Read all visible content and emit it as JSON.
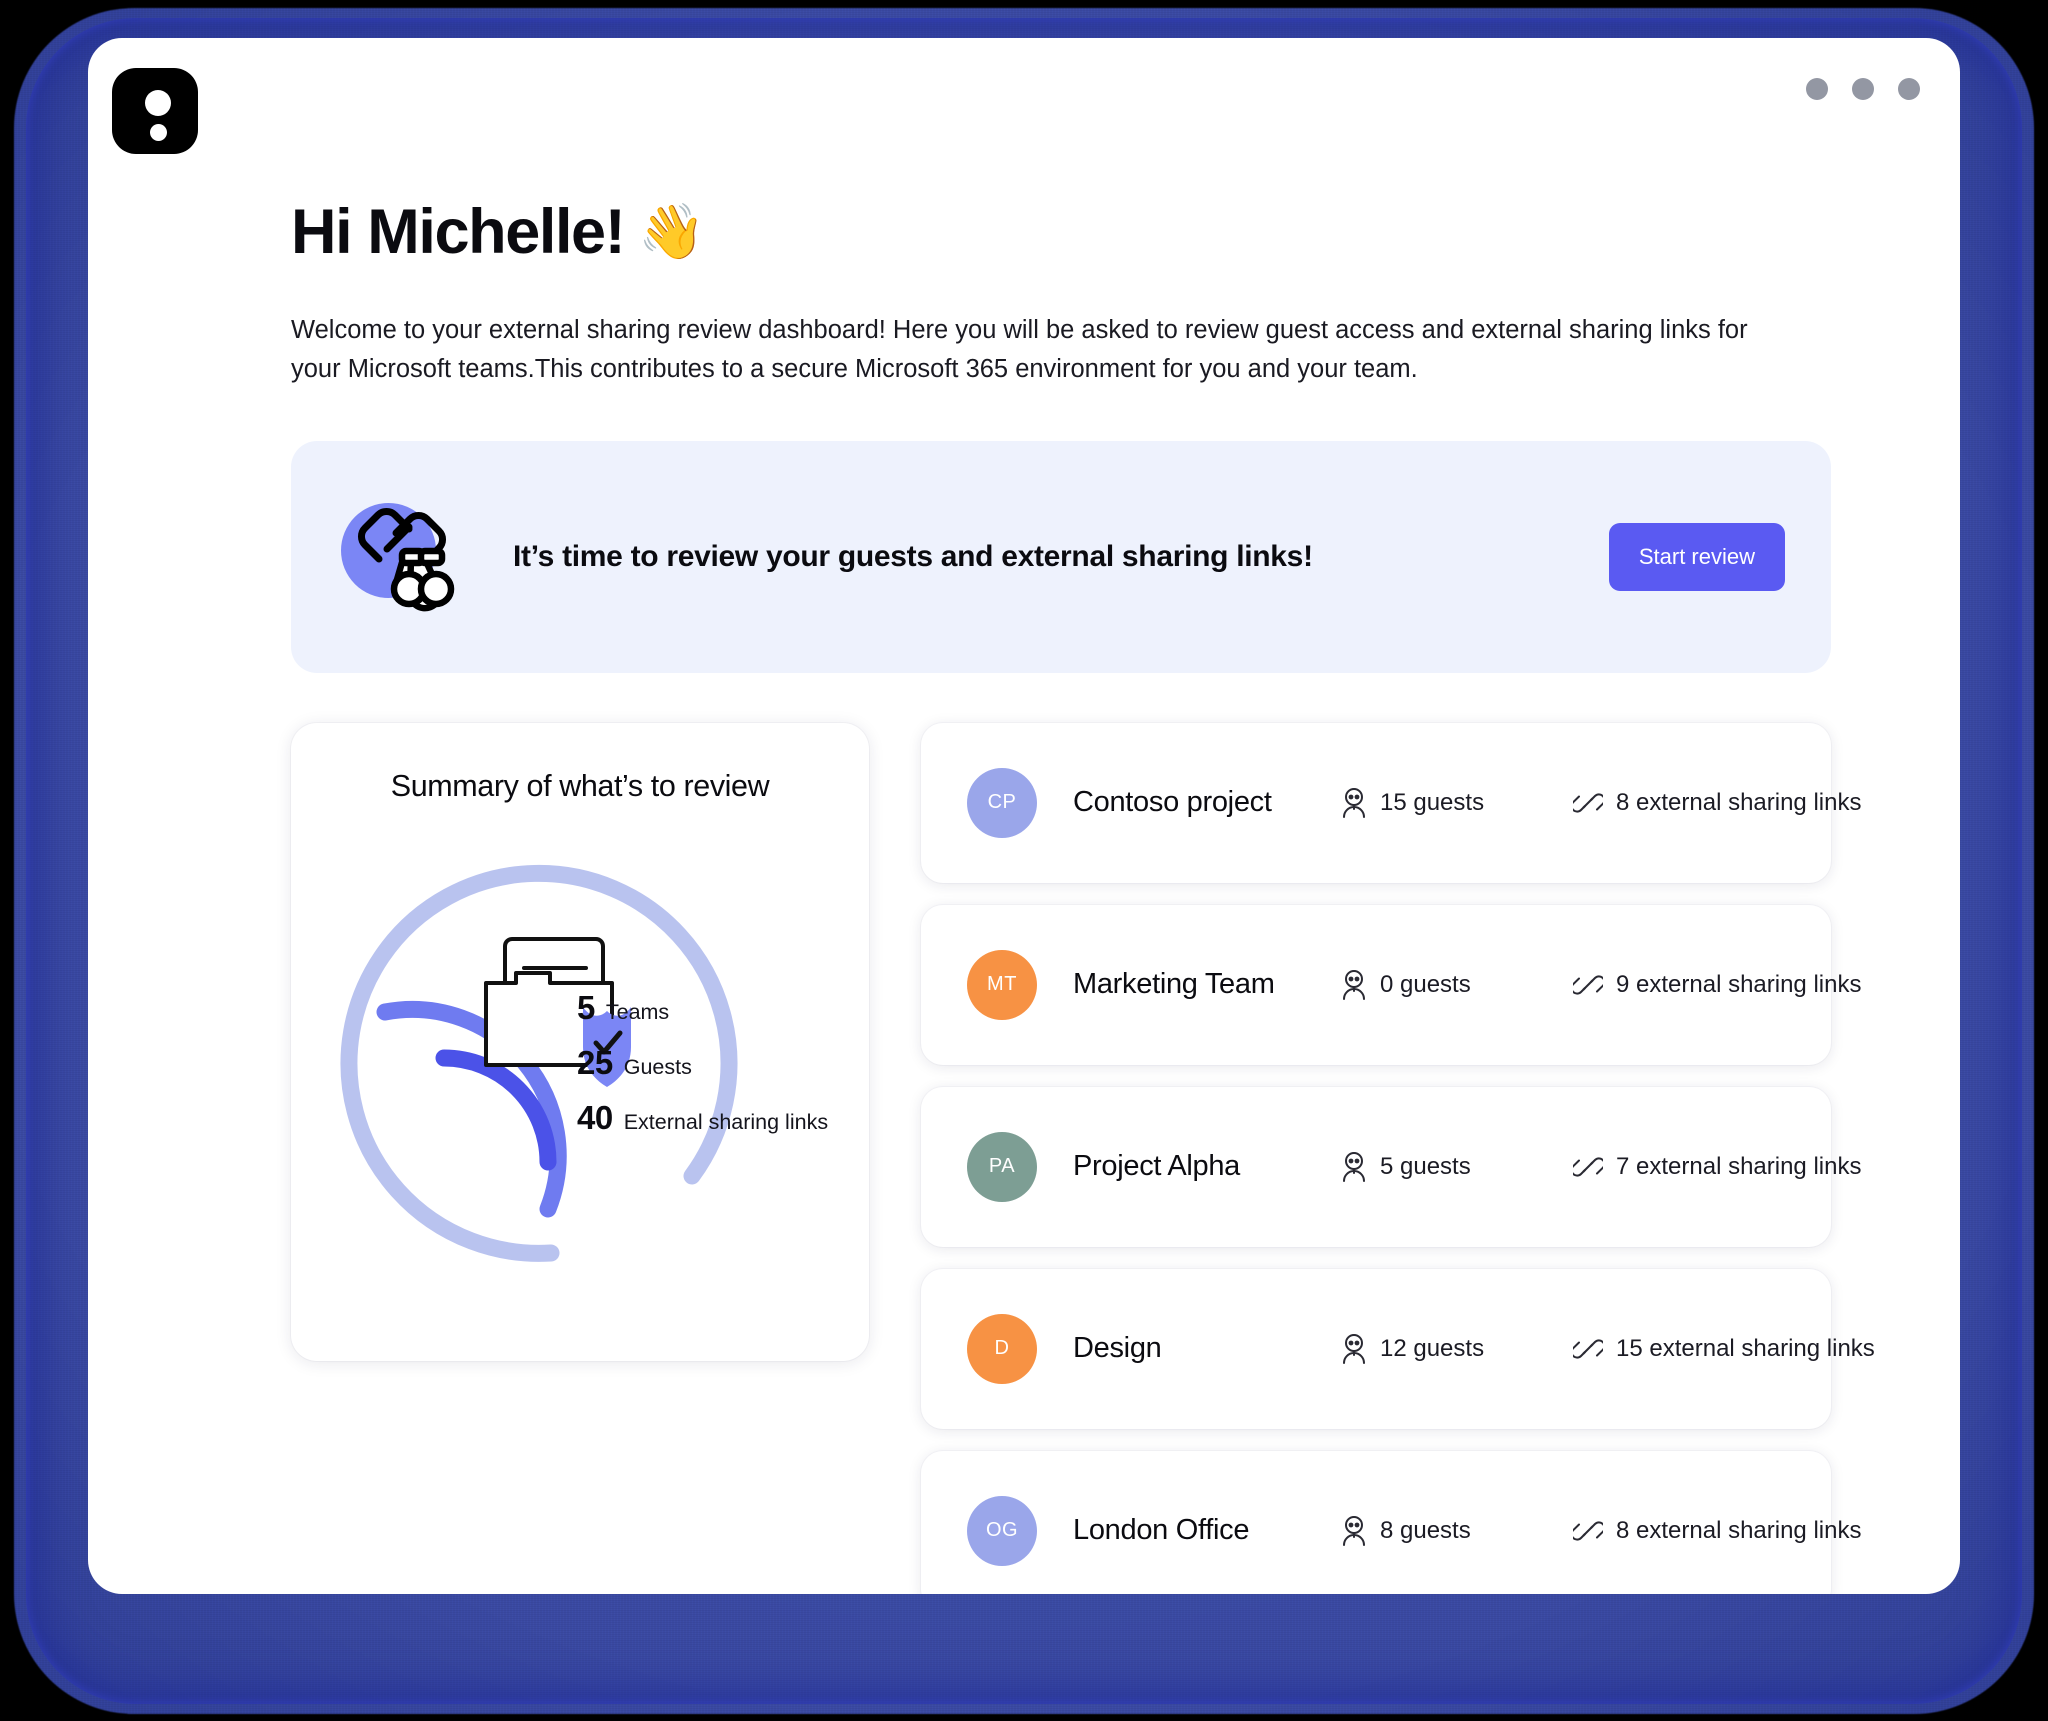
{
  "window": {
    "logo_icon": "app-logo-two-dots",
    "traffic_lights": [
      "dot-1",
      "dot-2",
      "dot-3"
    ]
  },
  "header": {
    "greeting": "Hi Michelle!",
    "wave_emoji": "👋",
    "intro": "Welcome to your external sharing review dashboard! Here you will be asked to review guest access and external sharing links for your Microsoft teams.This contributes to a secure Microsoft 365 environment for you and your team."
  },
  "banner": {
    "icon": "link-binoculars-icon",
    "title": "It’s time to review your guests and external sharing links!",
    "button_label": "Start review",
    "bg_color": "#eef2fd",
    "button_color": "#5a5af2"
  },
  "summary": {
    "title": "Summary of what’s to review",
    "center_icon": "folder-shield-check-icon",
    "legend": [
      {
        "value": "5",
        "label": "Teams",
        "color": "#4b52e8"
      },
      {
        "value": "25",
        "label": "Guests",
        "color": "#6f7bf0"
      },
      {
        "value": "40",
        "label": "External sharing links",
        "color": "#aab6ec"
      }
    ]
  },
  "chart_data": {
    "type": "pie",
    "title": "Summary of what’s to review",
    "categories": [
      "Teams",
      "Guests",
      "External sharing links"
    ],
    "values": [
      5,
      25,
      40
    ],
    "colors": [
      "#4b52e8",
      "#6f7bf0",
      "#aab6ec"
    ],
    "legend_position": "center-right",
    "grid": false,
    "note": "Concentric open arcs; outer light arc is the track, inner arcs scale with value"
  },
  "teams": {
    "guests_icon": "guest-person-icon",
    "links_icon": "chain-link-icon",
    "rows": [
      {
        "initials": "CP",
        "avatar_color": "#9aa6ea",
        "name": "Contoso project",
        "guests": "15 guests",
        "links": "8 external sharing links"
      },
      {
        "initials": "MT",
        "avatar_color": "#f79244",
        "name": "Marketing Team",
        "guests": "0 guests",
        "links": "9 external sharing links"
      },
      {
        "initials": "PA",
        "avatar_color": "#7d9e94",
        "name": "Project Alpha",
        "guests": "5 guests",
        "links": "7 external sharing links"
      },
      {
        "initials": "D",
        "avatar_color": "#f79244",
        "name": "Design",
        "guests": "12 guests",
        "links": "15 external sharing links"
      },
      {
        "initials": "OG",
        "avatar_color": "#9aa6ea",
        "name": "London Office",
        "guests": "8 guests",
        "links": "8 external sharing links"
      }
    ]
  }
}
